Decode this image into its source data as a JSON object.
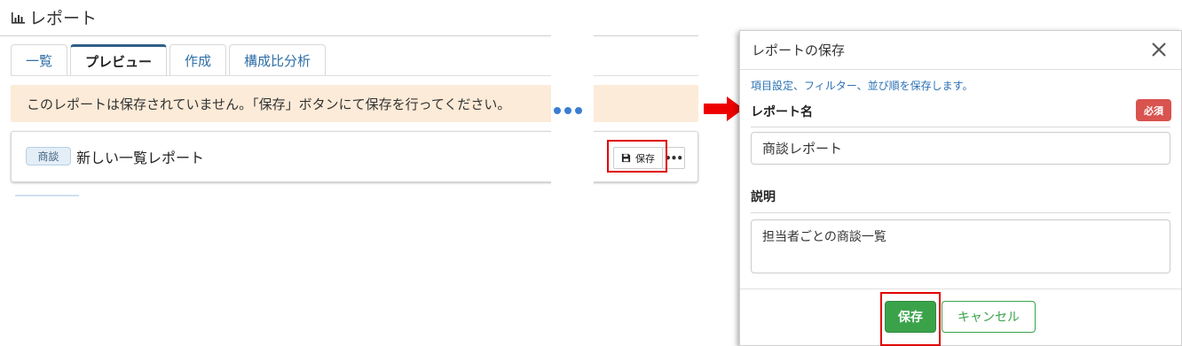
{
  "page": {
    "title": "レポート"
  },
  "tabs": [
    {
      "label": "一覧"
    },
    {
      "label": "プレビュー"
    },
    {
      "label": "作成"
    },
    {
      "label": "構成比分析"
    }
  ],
  "alert": {
    "text": "このレポートは保存されていません。「保存」ボタンにて保存を行ってください。"
  },
  "report": {
    "category": "商談",
    "name": "新しい一覧レポート",
    "save_label": "保存",
    "more_label": "•••"
  },
  "modal": {
    "title": "レポートの保存",
    "description": "項目設定、フィルター、並び順を保存します。",
    "name_label": "レポート名",
    "required_badge": "必須",
    "name_value": "商談レポート",
    "desc_label": "説明",
    "desc_value": "担当者ごとの商談一覧",
    "save_label": "保存",
    "cancel_label": "キャンセル"
  },
  "colors": {
    "accent_blue": "#2f6fa7",
    "alert_bg": "#fcebd8",
    "required_red": "#d9534f",
    "save_green": "#3aa34a",
    "highlight_red": "#e00000",
    "arrow_red": "#ee0000"
  },
  "icons": {
    "page_title": "bar-chart-icon",
    "save": "floppy-disk-icon",
    "close": "close-icon",
    "pointer": "right-arrow-icon"
  }
}
